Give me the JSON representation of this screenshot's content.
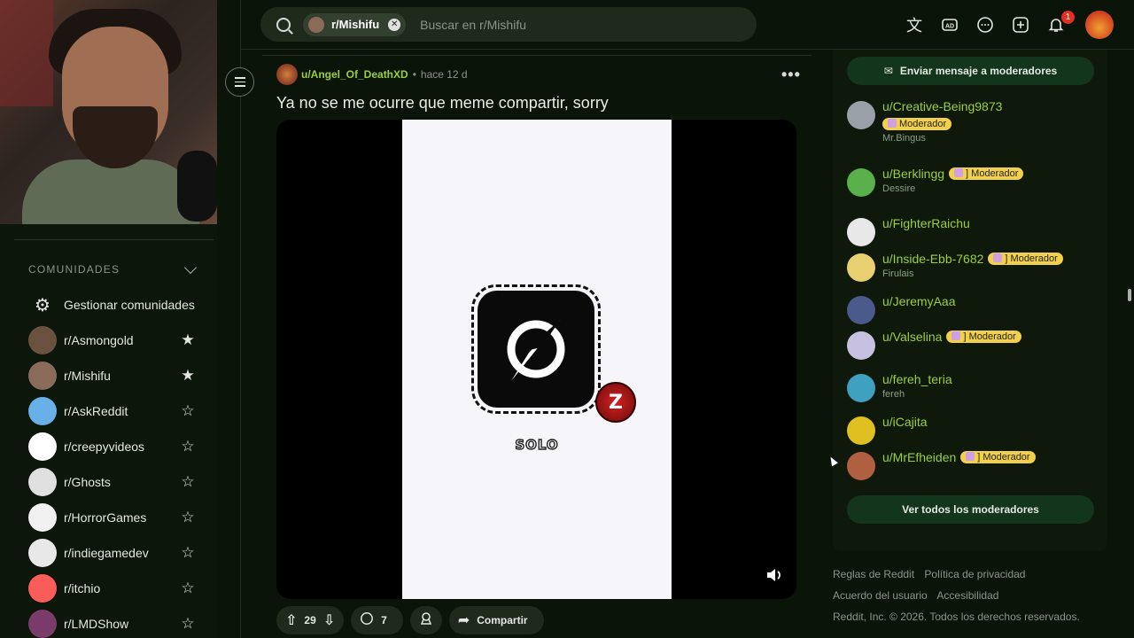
{
  "topbar": {
    "search_chip": "r/Mishifu",
    "search_placeholder": "Buscar en r/Mishifu",
    "notification_count": "1",
    "icons": [
      "translate-icon",
      "ads-icon",
      "chat-icon",
      "create-post-icon",
      "notification-icon"
    ]
  },
  "sidebar": {
    "section_title": "COMUNIDADES",
    "manage_label": "Gestionar comunidades",
    "communities": [
      {
        "name": "r/Asmongold",
        "starred": true,
        "color": "#6b5240"
      },
      {
        "name": "r/Mishifu",
        "starred": true,
        "color": "#8a6b5a"
      },
      {
        "name": "r/AskReddit",
        "starred": false,
        "color": "#6ab0e8"
      },
      {
        "name": "r/creepyvideos",
        "starred": false,
        "color": "#ffffff"
      },
      {
        "name": "r/Ghosts",
        "starred": false,
        "color": "#e0e0e0"
      },
      {
        "name": "r/HorrorGames",
        "starred": false,
        "color": "#f0f0f0"
      },
      {
        "name": "r/indiegamedev",
        "starred": false,
        "color": "#e8e8e8"
      },
      {
        "name": "r/itchio",
        "starred": false,
        "color": "#fa5c5c"
      },
      {
        "name": "r/LMDShow",
        "starred": false,
        "color": "#7a3a6a"
      }
    ]
  },
  "post": {
    "author": "u/Angel_Of_DeathXD",
    "separator": "•",
    "time": "hace 12 d",
    "title": "Ya no se me ocurre que meme compartir, sorry",
    "media_caption": "SOLO",
    "badge_letter": "Z",
    "votes": "29",
    "comments": "7",
    "share_label": "Compartir"
  },
  "right": {
    "message_mods_label": "Enviar mensaje a moderadores",
    "view_all_mods_label": "Ver todos los moderadores",
    "moderators": [
      {
        "name": "u/Creative-Being9873",
        "flair": "Moderador",
        "sub": "Mr.Bingus",
        "color": "#9aa0a8"
      },
      {
        "name": "u/Berklingg",
        "flair": "] Moderador",
        "sub": "Dessire",
        "color": "#5ab04a"
      },
      {
        "name": "u/FighterRaichu",
        "flair": "",
        "sub": "",
        "color": "#e8e8e8"
      },
      {
        "name": "u/Inside-Ebb-7682",
        "flair": "] Moderador",
        "sub": "Firulais",
        "color": "#e8d070"
      },
      {
        "name": "u/JeremyAaa",
        "flair": "",
        "sub": "",
        "color": "#4a5a8a"
      },
      {
        "name": "u/Valselina",
        "flair": "] Moderador",
        "sub": "",
        "color": "#c8c0e0"
      },
      {
        "name": "u/fereh_teria",
        "flair": "",
        "sub": "fereh",
        "color": "#40a0c0"
      },
      {
        "name": "u/iCajita",
        "flair": "",
        "sub": "",
        "color": "#e0c020"
      },
      {
        "name": "u/MrEfheiden",
        "flair": "] Moderador",
        "sub": "",
        "color": "#b06040"
      }
    ]
  },
  "footer": {
    "links_row1": [
      "Reglas de Reddit",
      "Política de privacidad"
    ],
    "links_row2": [
      "Acuerdo del usuario",
      "Accesibilidad"
    ],
    "copyright": "Reddit, Inc. © 2026. Todos los derechos reservados."
  }
}
